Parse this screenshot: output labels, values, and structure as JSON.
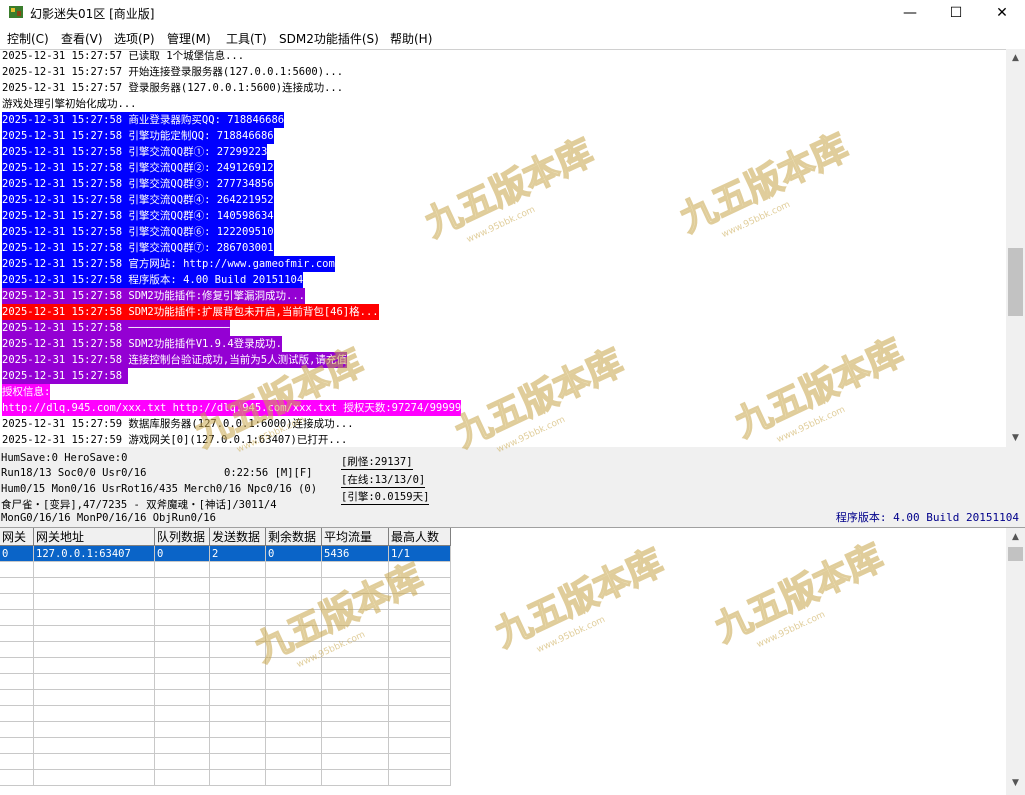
{
  "window": {
    "title": "幻影迷失01区 [商业版]",
    "minimize": "—",
    "maximize": "☐",
    "close": "✕"
  },
  "menu": [
    "控制(C)",
    "查看(V)",
    "选项(P)",
    "管理(M)",
    "工具(T)",
    "SDM2功能插件(S)",
    "帮助(H)"
  ],
  "log": [
    {
      "text": "2025-12-31 15:27:57 已读取 1个城堡信息...",
      "bg": "#ffffff",
      "fg": "#000000"
    },
    {
      "text": "2025-12-31 15:27:57 开始连接登录服务器(127.0.0.1:5600)...",
      "bg": "#ffffff",
      "fg": "#000000"
    },
    {
      "text": "2025-12-31 15:27:57 登录服务器(127.0.0.1:5600)连接成功...",
      "bg": "#ffffff",
      "fg": "#000000"
    },
    {
      "text": "游戏处理引擎初始化成功...",
      "bg": "#ffffff",
      "fg": "#000000"
    },
    {
      "text": "2025-12-31 15:27:58 商业登录器购买QQ: 718846686",
      "bg": "#0000ff",
      "fg": "#ffffff"
    },
    {
      "text": "2025-12-31 15:27:58 引擎功能定制QQ: 718846686",
      "bg": "#0000ff",
      "fg": "#ffffff"
    },
    {
      "text": "2025-12-31 15:27:58 引擎交流QQ群①: 27299223",
      "bg": "#0000ff",
      "fg": "#ffffff"
    },
    {
      "text": "2025-12-31 15:27:58 引擎交流QQ群②: 249126912",
      "bg": "#0000ff",
      "fg": "#ffffff"
    },
    {
      "text": "2025-12-31 15:27:58 引擎交流QQ群③: 277734856",
      "bg": "#0000ff",
      "fg": "#ffffff"
    },
    {
      "text": "2025-12-31 15:27:58 引擎交流QQ群④: 264221952",
      "bg": "#0000ff",
      "fg": "#ffffff"
    },
    {
      "text": "2025-12-31 15:27:58 引擎交流QQ群④: 140598634",
      "bg": "#0000ff",
      "fg": "#ffffff"
    },
    {
      "text": "2025-12-31 15:27:58 引擎交流QQ群⑥: 122209510",
      "bg": "#0000ff",
      "fg": "#ffffff"
    },
    {
      "text": "2025-12-31 15:27:58 引擎交流QQ群⑦: 286703001",
      "bg": "#0000ff",
      "fg": "#ffffff"
    },
    {
      "text": "2025-12-31 15:27:58 官方网站: http://www.gameofmir.com",
      "bg": "#0000ff",
      "fg": "#ffffff"
    },
    {
      "text": "2025-12-31 15:27:58 程序版本: 4.00 Build 20151104",
      "bg": "#0000ff",
      "fg": "#ffffff"
    },
    {
      "text": "2025-12-31 15:27:58 SDM2功能插件:修复引擎漏洞成功...",
      "bg": "#9400d3",
      "fg": "#ffffff"
    },
    {
      "text": "2025-12-31 15:27:58 SDM2功能插件:扩展背包未开启,当前背包[46]格...",
      "bg": "#ff0000",
      "fg": "#ffffff"
    },
    {
      "text": "2025-12-31 15:27:58 ────────────────",
      "bg": "#9400d3",
      "fg": "#ffffff"
    },
    {
      "text": "2025-12-31 15:27:58 SDM2功能插件V1.9.4登录成功.",
      "bg": "#9400d3",
      "fg": "#ffffff"
    },
    {
      "text": "2025-12-31 15:27:58 连接控制台验证成功,当前为5人测试版,请充值",
      "bg": "#9400d3",
      "fg": "#ffffff"
    },
    {
      "text": "2025-12-31 15:27:58 ",
      "bg": "#9400d3",
      "fg": "#ffffff"
    },
    {
      "text": "授权信息:",
      "bg": "#ff00ff",
      "fg": "#ffffff"
    },
    {
      "text": "http://dlq.945.com/xxx.txt http://dlq.945.com/xxx.txt 授权天数:97274/99999",
      "bg": "#ff00ff",
      "fg": "#ffffff"
    },
    {
      "text": "2025-12-31 15:27:59 数据库服务器(127.0.0.1:6000)连接成功...",
      "bg": "#ffffff",
      "fg": "#000000"
    },
    {
      "text": "2025-12-31 15:27:59 游戏网关[0](127.0.0.1:63407)已打开...",
      "bg": "#ffffff",
      "fg": "#000000"
    }
  ],
  "status": {
    "line1": "HumSave:0 HeroSave:0",
    "line2": "Run18/13 Soc0/0 Usr0/16",
    "time": "0:22:56 [M][F]",
    "line3": "Hum0/15 Mon0/16 UsrRot16/435 Merch0/16 Npc0/16 (0)",
    "line4": "食尸雀・[变异],47/7235 - 双斧魔魂・[神话]/3011/4",
    "line5": "MonG0/16/16 MonP0/16/16 ObjRun0/16",
    "refresh": "[刷怪:29137]",
    "online": "[在线:13/13/0]",
    "engine": "[引擎:0.0159天]",
    "version": "程序版本: 4.00 Build 20151104"
  },
  "grid": {
    "headers": [
      "网关",
      "网关地址",
      "队列数据",
      "发送数据",
      "剩余数据",
      "平均流量",
      "最高人数"
    ],
    "rows": [
      [
        "0",
        "127.0.0.1:63407",
        "0",
        "2",
        "0",
        "5436",
        "1/1"
      ]
    ]
  },
  "watermark": {
    "text": "九五版本库",
    "sub": "www.95bbk.com"
  },
  "colors": {
    "selection": "#0a64c8",
    "version_text": "#00008b"
  }
}
